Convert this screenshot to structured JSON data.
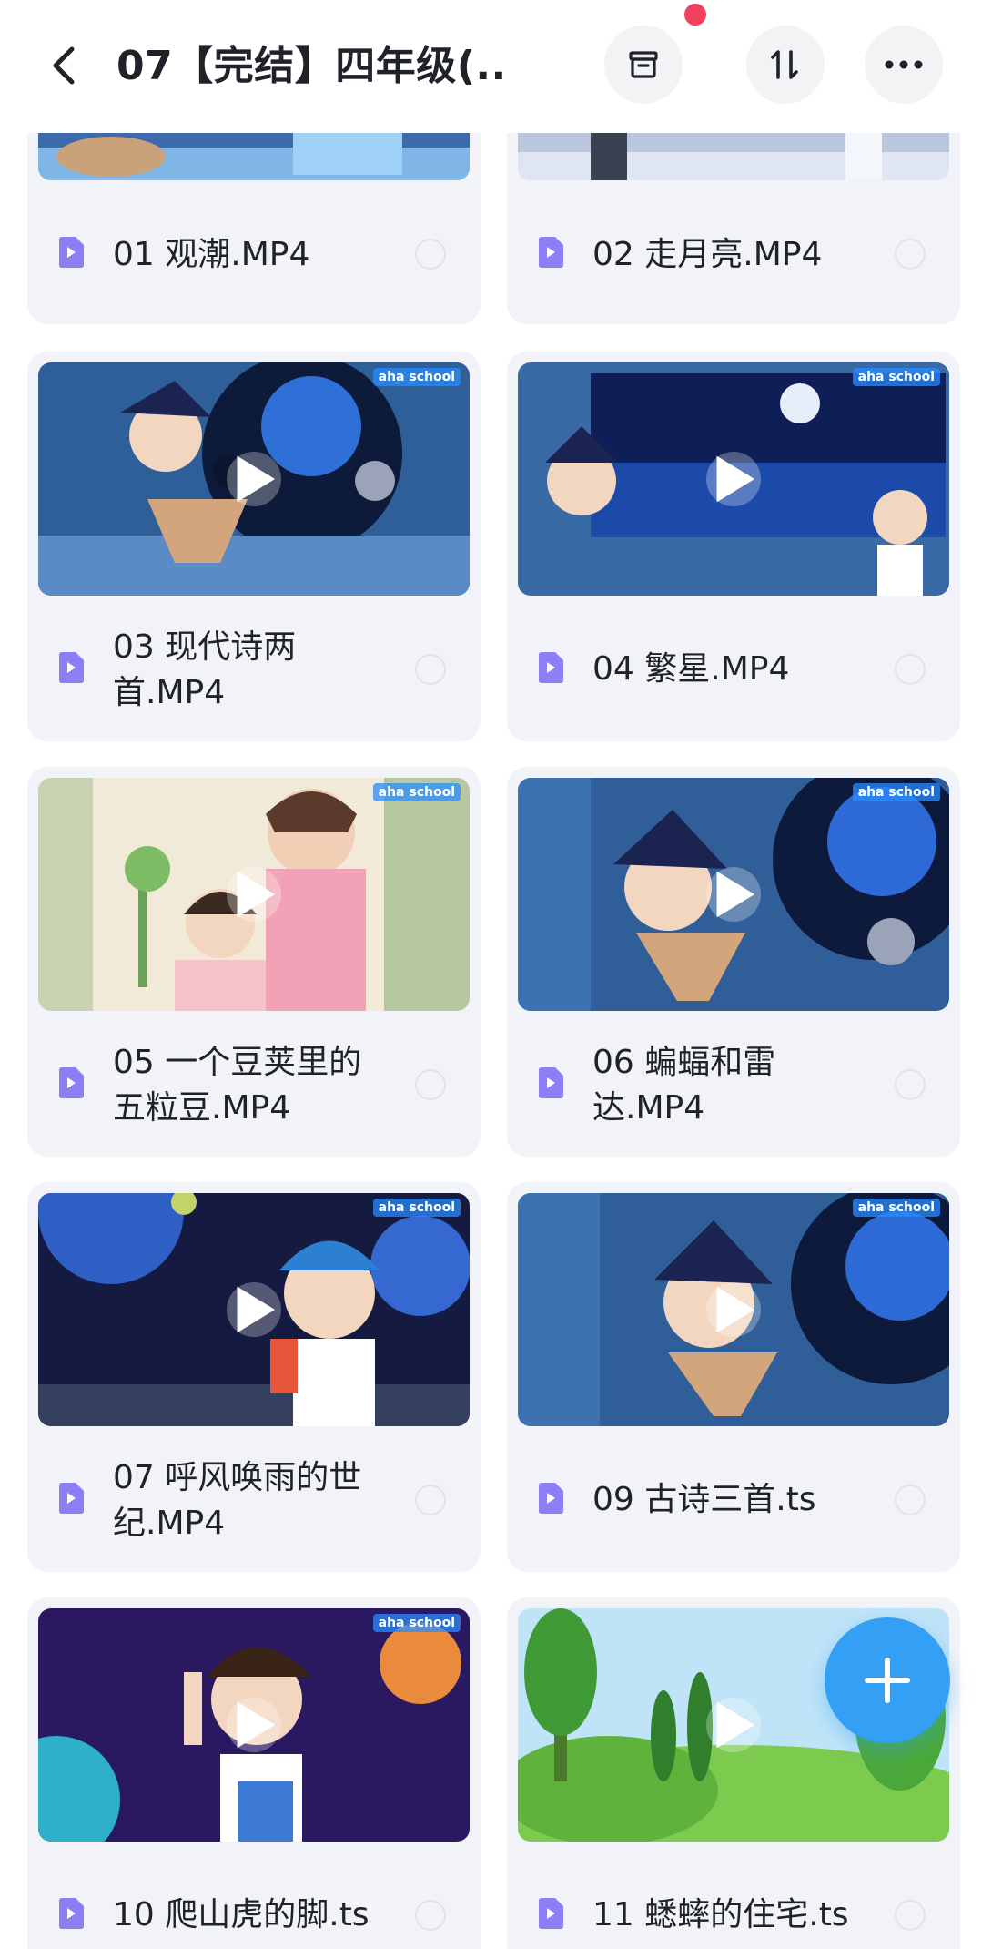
{
  "header": {
    "title": "07【完结】四年级(...",
    "back_icon": "chevron-left-icon",
    "actions": [
      {
        "name": "archive-button",
        "icon": "archive-icon"
      },
      {
        "name": "sort-button",
        "icon": "sort-icon"
      },
      {
        "name": "more-button",
        "icon": "more-horizontal-icon"
      }
    ],
    "notification_dot_color": "#f0405e"
  },
  "files": [
    {
      "name": "01 观潮.MP4",
      "type": "video"
    },
    {
      "name": "02 走月亮.MP4",
      "type": "video"
    },
    {
      "name": "03 现代诗两首.MP4",
      "type": "video",
      "line1": "03 现代诗两",
      "line2": "首.MP4"
    },
    {
      "name": "04 繁星.MP4",
      "type": "video"
    },
    {
      "name": "05 一个豆荚里的五粒豆.MP4",
      "type": "video",
      "line1": "05 一个豆荚里的",
      "line2": "五粒豆.MP4"
    },
    {
      "name": "06 蝙蝠和雷达.MP4",
      "type": "video",
      "line1": "06 蝙蝠和雷",
      "line2": "达.MP4"
    },
    {
      "name": "07 呼风唤雨的世纪.MP4",
      "type": "video",
      "line1": "07 呼风唤雨的世",
      "line2": "纪.MP4"
    },
    {
      "name": "09 古诗三首.ts",
      "type": "video"
    },
    {
      "name": "10 爬山虎的脚.ts",
      "type": "video"
    },
    {
      "name": "11 蟋蟀的住宅.ts",
      "type": "video"
    }
  ],
  "thumbnail_branding": "aha school",
  "colors": {
    "accent": "#33a0f6",
    "card_bg": "#f2f3f8",
    "file_icon": "#8b7ff5"
  },
  "fab": {
    "icon": "plus-icon"
  }
}
